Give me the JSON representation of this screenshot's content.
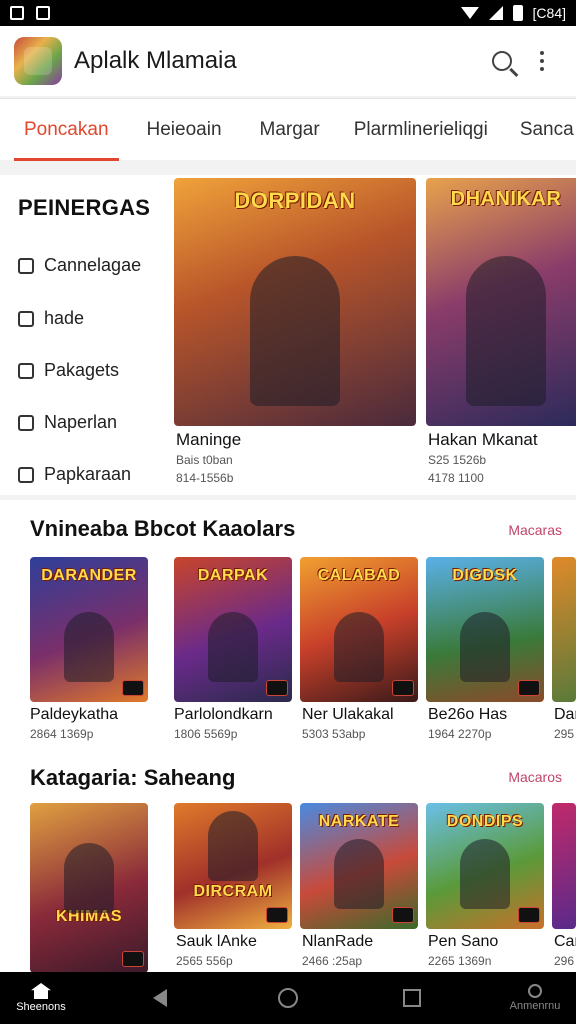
{
  "status_bar": {
    "clock": "[C84]"
  },
  "app": {
    "title": "Aplalk Mlamaia"
  },
  "tabs": [
    {
      "label": "Poncakan",
      "active": true
    },
    {
      "label": "Heieoain",
      "active": false
    },
    {
      "label": "Margar",
      "active": false
    },
    {
      "label": "Plarmlinerieliqgi",
      "active": false
    },
    {
      "label": "Sanca",
      "active": false
    }
  ],
  "sidebar": {
    "title": "PEINERGAS",
    "items": [
      {
        "label": "Cannelagae",
        "icon": "camera-icon"
      },
      {
        "label": "hade",
        "icon": "square-icon"
      },
      {
        "label": "Pakagets",
        "icon": "book-icon"
      },
      {
        "label": "Naperlan",
        "icon": "bookmark-icon"
      },
      {
        "label": "Papkaraan",
        "icon": "folder-icon"
      }
    ]
  },
  "featured": [
    {
      "art_title": "DORPIDAN",
      "title": "Maninge",
      "meta1": "Bais t0ban",
      "meta2": "814-1556b"
    },
    {
      "art_title": "DHANIKAR",
      "title": "Hakan Mkanat",
      "meta1": "S25 1526b",
      "meta2": "4178 1100"
    }
  ],
  "section1": {
    "title": "Vnineaba Bbcot Kaaolars",
    "more": "Macaras",
    "cards": [
      {
        "art_title": "DARANDER",
        "title": "Paldeykatha",
        "meta": "2864 1369p"
      },
      {
        "art_title": "DARPAK",
        "title": "Parlolondkarn",
        "meta": "1806 5569p"
      },
      {
        "art_title": "CALABAD",
        "title": "Ner Ulakakal",
        "meta": "5303 53abp"
      },
      {
        "art_title": "DIGDSK",
        "title": "Be26o Has",
        "meta": "1964 2270p"
      },
      {
        "art_title": "",
        "title": "Dar",
        "meta": "295"
      }
    ]
  },
  "section2": {
    "title": "Katagaria:  Saheang",
    "more": "Macaros",
    "cards": [
      {
        "art_title": "KHIMAS",
        "title": "",
        "meta": ""
      },
      {
        "art_title": "DIRCRAM",
        "title": "Sauk lAnke",
        "meta": "2565 556p"
      },
      {
        "art_title": "NARKATE",
        "title": "NlanRade",
        "meta": "2466 :25ap"
      },
      {
        "art_title": "DONDIPS",
        "title": "Pen Sano",
        "meta": "2265 1369n"
      },
      {
        "art_title": "",
        "title": "Car",
        "meta": "296"
      }
    ]
  },
  "navbar": {
    "home_label": "Sheenons",
    "profile_label": "Anmenrnu"
  },
  "colors": {
    "accent": "#e0472e",
    "more_link": "#c0456a"
  }
}
